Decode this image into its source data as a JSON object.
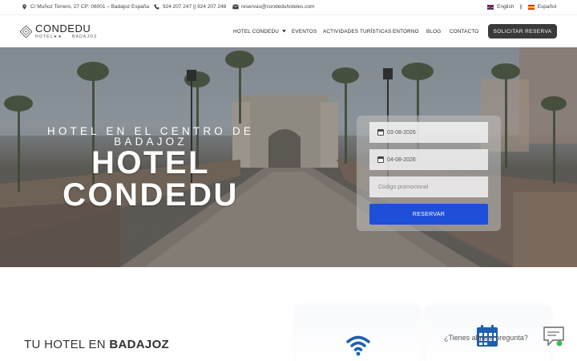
{
  "topbar": {
    "address": "C/ Muñoz Torrero, 27 CP: 06001 – Badajoz España",
    "phone": "924 207 247 || 924 207 248",
    "email": "reservas@condeduhoteles.com",
    "lang_english": "English",
    "lang_separator": "||",
    "lang_spanish": "Español"
  },
  "header": {
    "logo_name": "CONDEDU",
    "logo_sub_left": "HOTEL★★",
    "logo_sub_right": "BADAJOZ",
    "nav": [
      "HOTEL CONDEDU",
      "EVENTOS",
      "ACTIVIDADES TURÍSTICAS",
      "ENTORNO",
      "BLOG",
      "CONTACTO"
    ],
    "cta": "SOLICITAR RESERVA"
  },
  "hero": {
    "subtitle_line1": "HOTEL EN EL CENTRO DE",
    "subtitle_line2": "BADAJOZ",
    "title_line1": "HOTEL",
    "title_line2": "CONDEDU"
  },
  "booking": {
    "checkin": "03-08-2026",
    "checkout": "04-08-2026",
    "promo_placeholder": "Código promocional",
    "submit": "RESERVAR"
  },
  "section": {
    "title_prefix": "TU HOTEL EN ",
    "title_bold": "BADAJOZ"
  },
  "chat": {
    "question": "¿Tienes alguna pregunta?"
  },
  "colors": {
    "accent_blue": "#1f4fd8",
    "dark_button": "#3a3a3a"
  }
}
